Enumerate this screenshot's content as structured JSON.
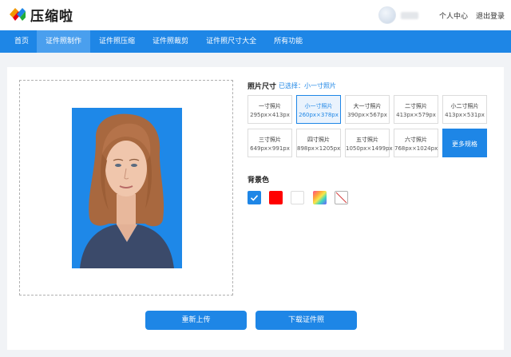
{
  "header": {
    "brand": "压缩啦",
    "user_center": "个人中心",
    "logout": "退出登录"
  },
  "nav": {
    "items": [
      "首页",
      "证件照制作",
      "证件照压缩",
      "证件照裁剪",
      "证件照尺寸大全",
      "所有功能"
    ],
    "active_index": 1
  },
  "photo_section": {
    "background_color": "#1e88e8"
  },
  "size_section": {
    "title": "照片尺寸",
    "selected_hint": "已选择：小一寸照片",
    "sizes": [
      {
        "name": "一寸照片",
        "dim": "295px×413px"
      },
      {
        "name": "小一寸照片",
        "dim": "260px×378px"
      },
      {
        "name": "大一寸照片",
        "dim": "390px×567px"
      },
      {
        "name": "二寸照片",
        "dim": "413px×579px"
      },
      {
        "name": "小二寸照片",
        "dim": "413px×531px"
      },
      {
        "name": "三寸照片",
        "dim": "649px×991px"
      },
      {
        "name": "四寸照片",
        "dim": "898px×1205px"
      },
      {
        "name": "五寸照片",
        "dim": "1050px×1499px"
      },
      {
        "name": "六寸照片",
        "dim": "768px×1024px"
      }
    ],
    "more_label": "更多规格"
  },
  "background_section": {
    "title": "背景色",
    "swatches": [
      {
        "name": "blue",
        "color": "#1e86e6",
        "selected": true
      },
      {
        "name": "red",
        "color": "#ff0000",
        "selected": false
      },
      {
        "name": "white",
        "color": "#ffffff",
        "selected": false
      },
      {
        "name": "gradient",
        "color": "gradient",
        "selected": false
      },
      {
        "name": "transparent",
        "color": "none",
        "selected": false
      }
    ]
  },
  "actions": {
    "reupload": "重新上传",
    "download": "下载证件照"
  }
}
